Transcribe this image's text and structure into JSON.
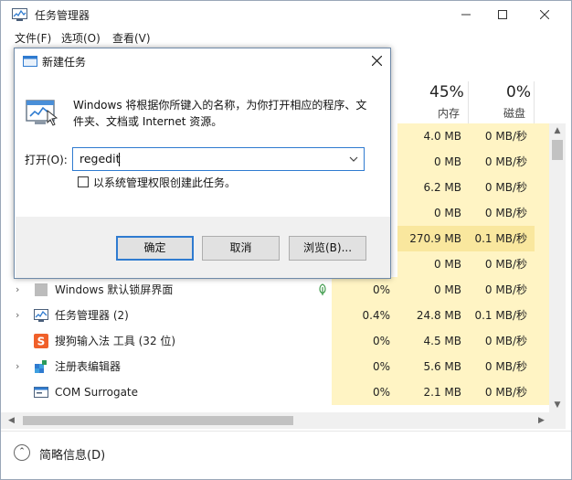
{
  "task_manager": {
    "title": "任务管理器",
    "menu": [
      "文件(F)",
      "选项(O)",
      "查看(V)"
    ],
    "columns": {
      "memory": {
        "percent": "45%",
        "label": "内存"
      },
      "disk": {
        "percent": "0%",
        "label": "磁盘"
      }
    },
    "rows": [
      {
        "mem": "4.0 MB",
        "disk": "0 MB/秒"
      },
      {
        "mem": "0 MB",
        "disk": "0 MB/秒"
      },
      {
        "mem": "6.2 MB",
        "disk": "0 MB/秒"
      },
      {
        "mem": "0 MB",
        "disk": "0 MB/秒"
      },
      {
        "mem": "270.9 MB",
        "disk": "0.1 MB/秒"
      },
      {
        "mem": "0 MB",
        "disk": "0 MB/秒"
      },
      {
        "name": "Windows 默认锁屏界面",
        "cpu": "0%",
        "mem": "0 MB",
        "disk": "0 MB/秒"
      },
      {
        "name": "任务管理器 (2)",
        "cpu": "0.4%",
        "mem": "24.8 MB",
        "disk": "0.1 MB/秒"
      },
      {
        "name": "搜狗输入法 工具 (32 位)",
        "cpu": "0%",
        "mem": "4.5 MB",
        "disk": "0 MB/秒"
      },
      {
        "name": "注册表编辑器",
        "cpu": "0%",
        "mem": "5.6 MB",
        "disk": "0 MB/秒"
      },
      {
        "name": "COM Surrogate",
        "cpu": "0%",
        "mem": "2.1 MB",
        "disk": "0 MB/秒"
      }
    ],
    "footer_label": "简略信息(D)"
  },
  "run_dialog": {
    "title": "新建任务",
    "description": "Windows 将根据你所键入的名称，为你打开相应的程序、文件夹、文档或 Internet 资源。",
    "open_label": "打开(O):",
    "input_value": "regedit",
    "admin_checkbox_label": "以系统管理权限创建此任务。",
    "ok_label": "确定",
    "cancel_label": "取消",
    "browse_label": "浏览(B)..."
  },
  "colors": {
    "accent": "#2f7bd0",
    "usage_light": "#fff4c4",
    "usage_medium": "#f9e79e"
  }
}
